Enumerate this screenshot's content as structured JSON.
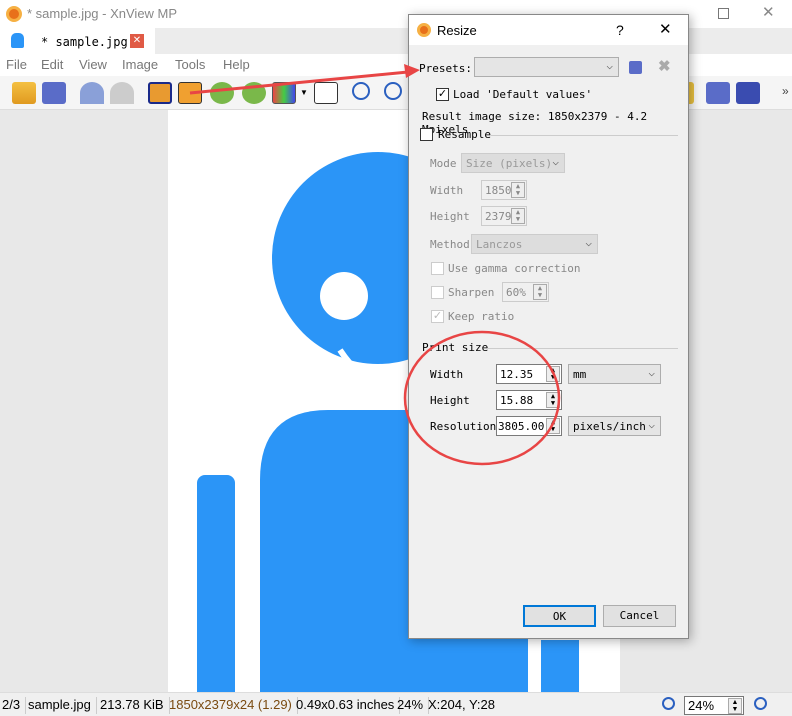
{
  "window": {
    "title": "* sample.jpg - XnView MP"
  },
  "tab": {
    "label": "* sample.jpg"
  },
  "menu": [
    "File",
    "Edit",
    "View",
    "Image",
    "Tools",
    "Help"
  ],
  "toolbar": {
    "overflow": "»"
  },
  "status": {
    "index": "2/3",
    "filename": "sample.jpg",
    "filesize": "213.78 KiB",
    "dimensions": "1850x2379x24 (1.29)",
    "print_size": "0.49x0.63 inches",
    "zoom": "24%",
    "coords": "X:204, Y:28",
    "zoom_input": "24%"
  },
  "dialog": {
    "title": "Resize",
    "help": "?",
    "close": "✕",
    "presets_label": "Presets:",
    "presets_value": "",
    "load_defaults": "Load 'Default values'",
    "load_defaults_checked": true,
    "result": "Result image size: 1850x2379 - 4.2 Mpixels",
    "resample": "Resample",
    "resample_checked": false,
    "mode_label": "Mode",
    "mode_value": "Size (pixels)",
    "width_label": "Width",
    "width_value": "1850",
    "height_label": "Height",
    "height_value": "2379",
    "method_label": "Method",
    "method_value": "Lanczos",
    "gamma": "Use gamma correction",
    "sharpen": "Sharpen",
    "sharpen_value": "60%",
    "keep_ratio": "Keep ratio",
    "print_size": "Print size",
    "p_width_label": "Width",
    "p_width": "12.35",
    "p_width_unit": "mm",
    "p_height_label": "Height",
    "p_height": "15.88",
    "resolution_label": "Resolution",
    "resolution": "3805.00",
    "resolution_unit": "pixels/inch",
    "ok": "OK",
    "cancel": "Cancel"
  },
  "colors": {
    "accent": "#2b95f7",
    "annotation": "#e84545"
  }
}
